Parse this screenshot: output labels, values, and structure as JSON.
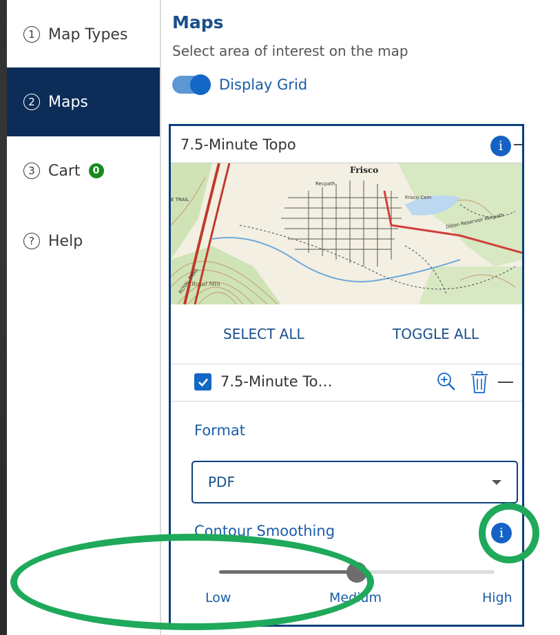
{
  "sidebar": {
    "items": [
      {
        "number": "1",
        "label": "Map Types"
      },
      {
        "number": "2",
        "label": "Maps"
      },
      {
        "number": "3",
        "label": "Cart",
        "badge": "0"
      },
      {
        "number": "?",
        "label": "Help"
      }
    ],
    "active_index": 1
  },
  "main": {
    "title": "Maps",
    "subtitle": "Select area of interest on the map",
    "grid_toggle": {
      "label": "Display Grid",
      "on": true
    }
  },
  "card": {
    "title": "7.5-Minute Topo",
    "info_icon": "info-icon",
    "thumbnail_labels": [
      "Frisco",
      "Recpath",
      "Frisco Cem",
      "Dillon Reservoir Recpath",
      "Royal Mtn",
      "ROYAL TRAIL",
      "E TRAIL"
    ],
    "select_all": "SELECT ALL",
    "toggle_all": "TOGGLE ALL",
    "item": {
      "label": "7.5-Minute To…",
      "checked": true,
      "zoom_icon": "zoom-in-icon",
      "trash_icon": "trash-icon"
    },
    "format": {
      "label": "Format",
      "value": "PDF"
    },
    "contour": {
      "label": "Contour Smoothing",
      "level": 0.5,
      "ticks": [
        "Low",
        "Medium",
        "High"
      ]
    }
  },
  "colors": {
    "nav_active": "#0b2d57",
    "accent": "#1467c5",
    "badge": "#178a1e",
    "highlight": "#1fa95a"
  }
}
